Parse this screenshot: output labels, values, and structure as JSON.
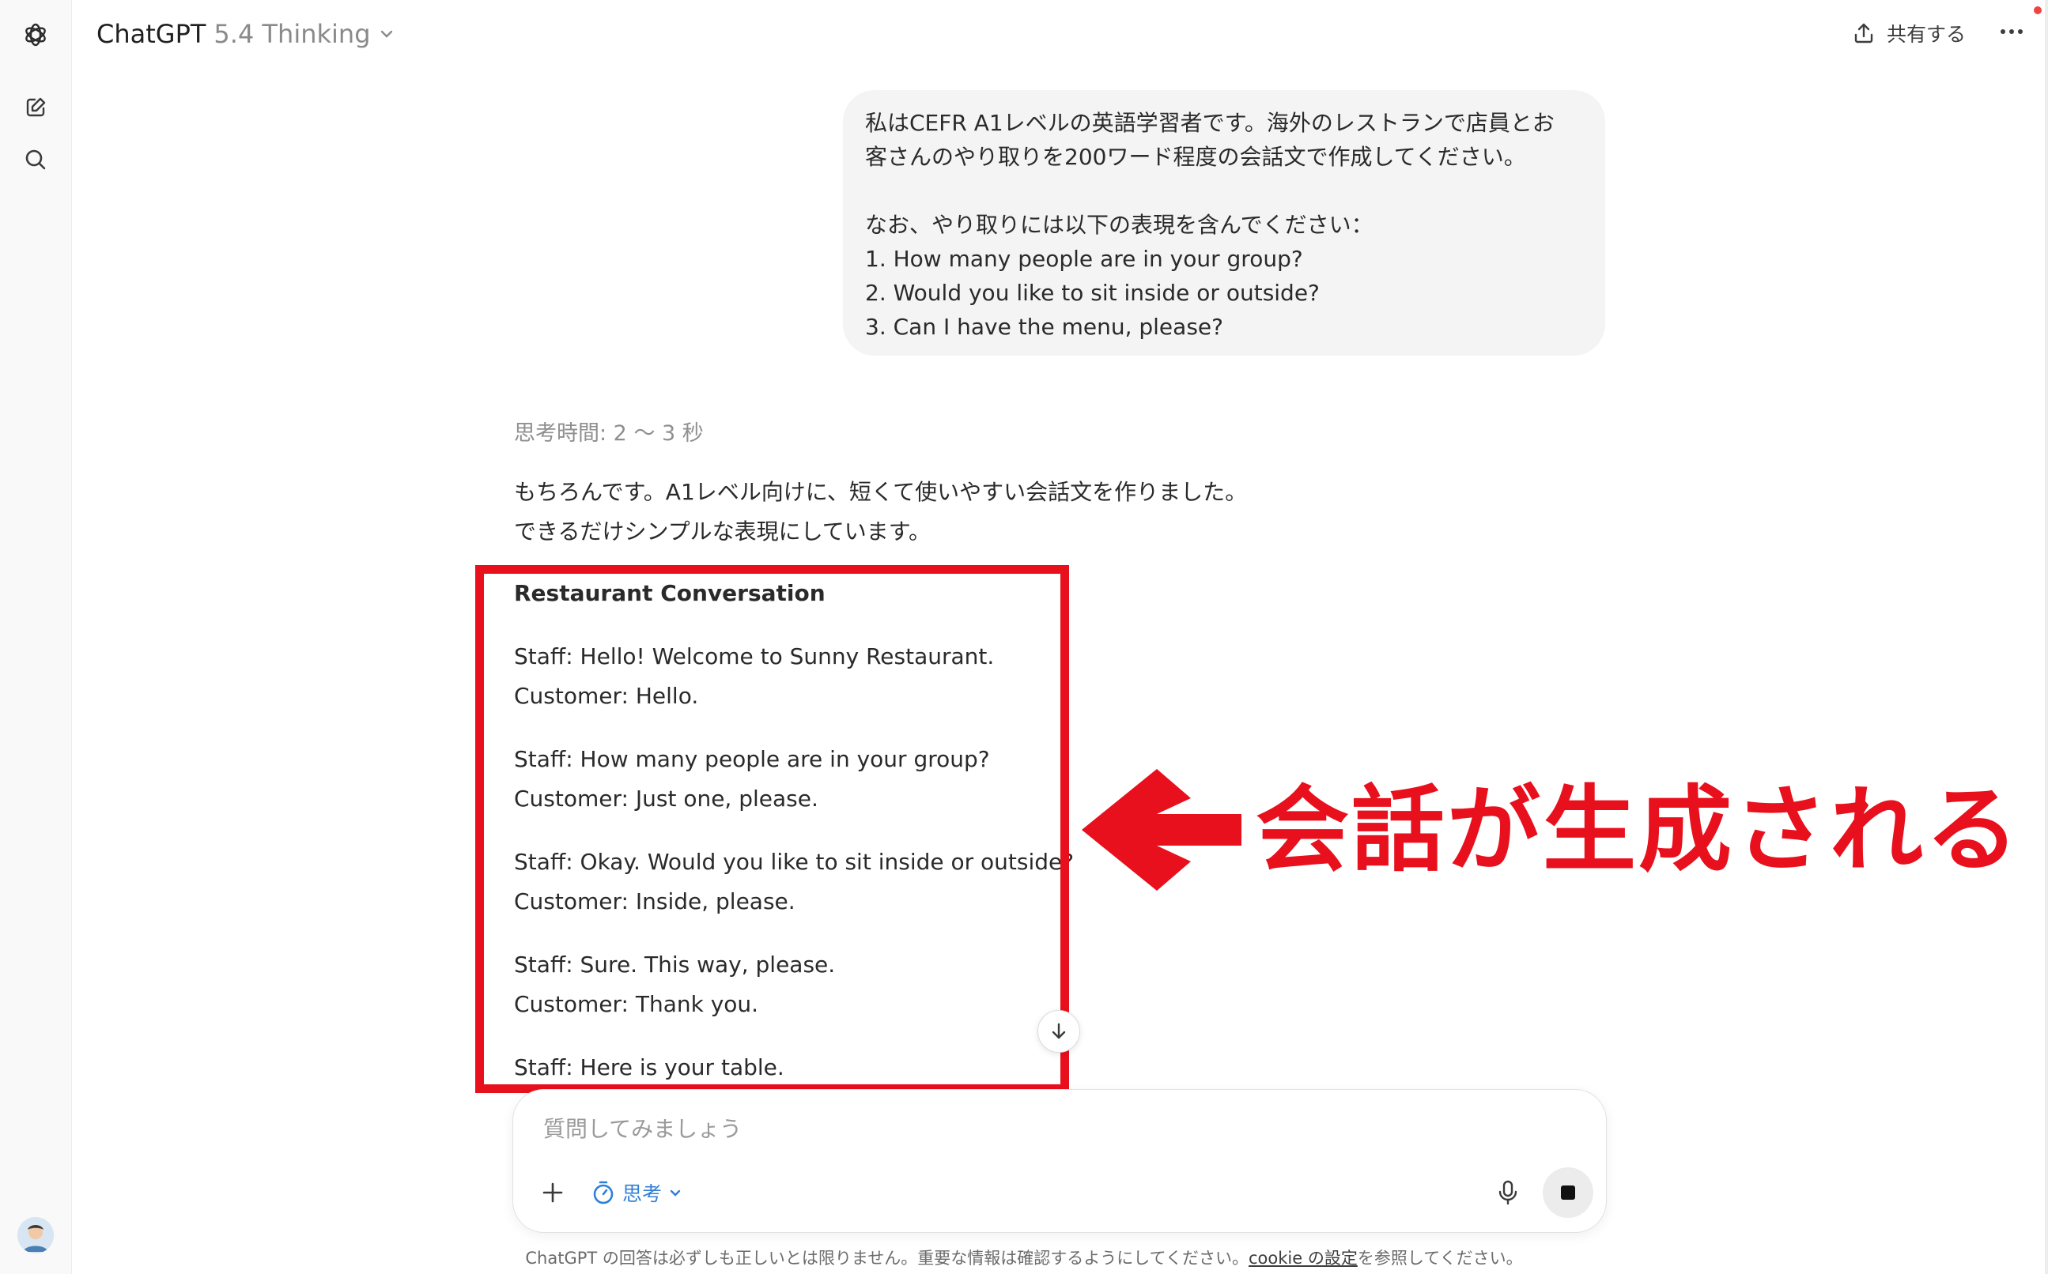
{
  "header": {
    "app_name": "ChatGPT",
    "model": "5.4 Thinking",
    "share_label": "共有する"
  },
  "sidebar": {
    "icons": [
      "chatgpt-logo-icon",
      "new-chat-icon",
      "search-icon"
    ]
  },
  "user_message": {
    "lines": [
      "私はCEFR A1レベルの英語学習者です。海外のレストランで店員とお",
      "客さんのやり取りを200ワード程度の会話文で作成してください。",
      "",
      "なお、やり取りには以下の表現を含んでください：",
      "1. How many people are in your group?",
      "2. Would you like to sit inside or outside?",
      "3. Can I have the menu, please?"
    ]
  },
  "assistant": {
    "thinking_time": "思考時間: 2 〜 3 秒",
    "intro_lines": [
      "もちろんです。A1レベル向けに、短くて使いやすい会話文を作りました。",
      "できるだけシンプルな表現にしています。"
    ],
    "conversation_title": "Restaurant Conversation",
    "conversation": [
      "Staff: Hello! Welcome to Sunny Restaurant.",
      "Customer: Hello.",
      "Staff: How many people are in your group?",
      "Customer: Just one, please.",
      "Staff: Okay. Would you like to sit inside or outside?",
      "Customer: Inside, please.",
      "Staff: Sure. This way, please.",
      "Customer: Thank you.",
      "Staff: Here is your table."
    ]
  },
  "annotation": {
    "text": "会話が生成される",
    "color": "#e8101c"
  },
  "composer": {
    "placeholder": "質問してみましょう",
    "mode_label": "思考"
  },
  "footer": {
    "text_before": "ChatGPT の回答は必ずしも正しいとは限りません。重要な情報は確認するようにしてください。",
    "link": "cookie の設定",
    "text_after": "を参照してください。"
  }
}
